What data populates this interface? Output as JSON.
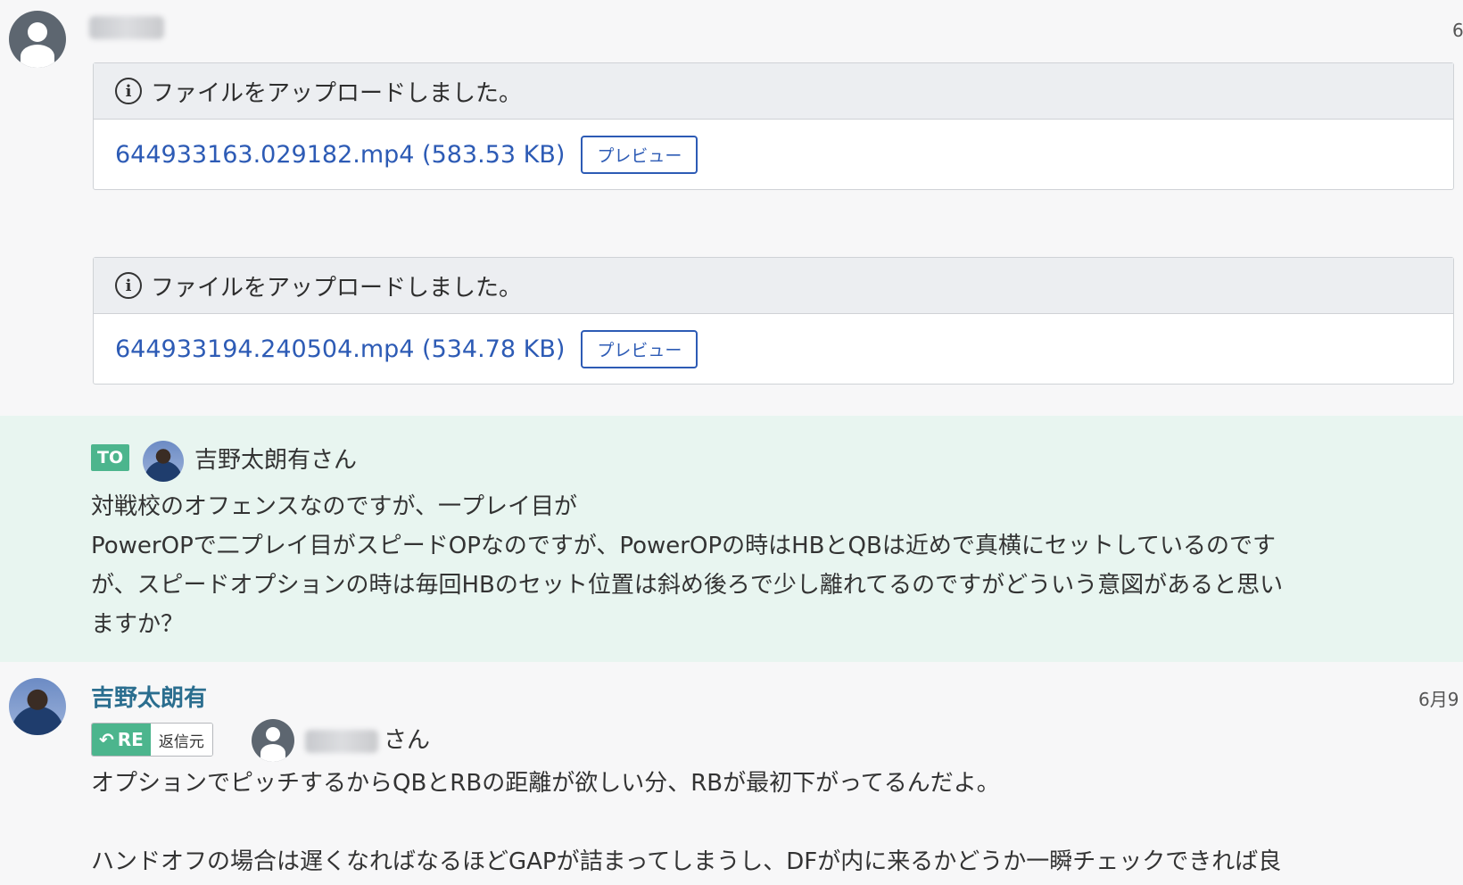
{
  "colors": {
    "link": "#2d5bb5",
    "mention_bg": "#e8f5f0",
    "badge_green": "#4cb58d",
    "bg": "#f7f7f8"
  },
  "message1": {
    "date": "6",
    "uploads": [
      {
        "header": "ファイルをアップロードしました。",
        "file": "644933163.029182.mp4 (583.53 KB)",
        "button": "プレビュー"
      },
      {
        "header": "ファイルをアップロードしました。",
        "file": "644933194.240504.mp4 (534.78 KB)",
        "button": "プレビュー"
      }
    ]
  },
  "mention": {
    "badge": "TO",
    "name": "吉野太朗有さん",
    "lines": [
      "対戦校のオフェンスなのですが、一プレイ目が",
      "PowerOPで二プレイ目がスピードOPなのですが、PowerOPの時はHBとQBは近めで真横にセットしているのです",
      "が、スピードオプションの時は毎回HBのセット位置は斜め後ろで少し離れてるのですがどういう意図があると思い",
      "ますか？"
    ]
  },
  "reply": {
    "author": "吉野太朗有",
    "date": "6月9",
    "re_label": "RE",
    "re_source": "返信元",
    "san": "さん",
    "line1": "オプションでピッチするからQBとRBの距離が欲しい分、RBが最初下がってるんだよ。",
    "line2": "ハンドオフの場合は遅くなればなるほどGAPが詰まってしまうし、DFが内に来るかどうか一瞬チェックできれば良"
  }
}
